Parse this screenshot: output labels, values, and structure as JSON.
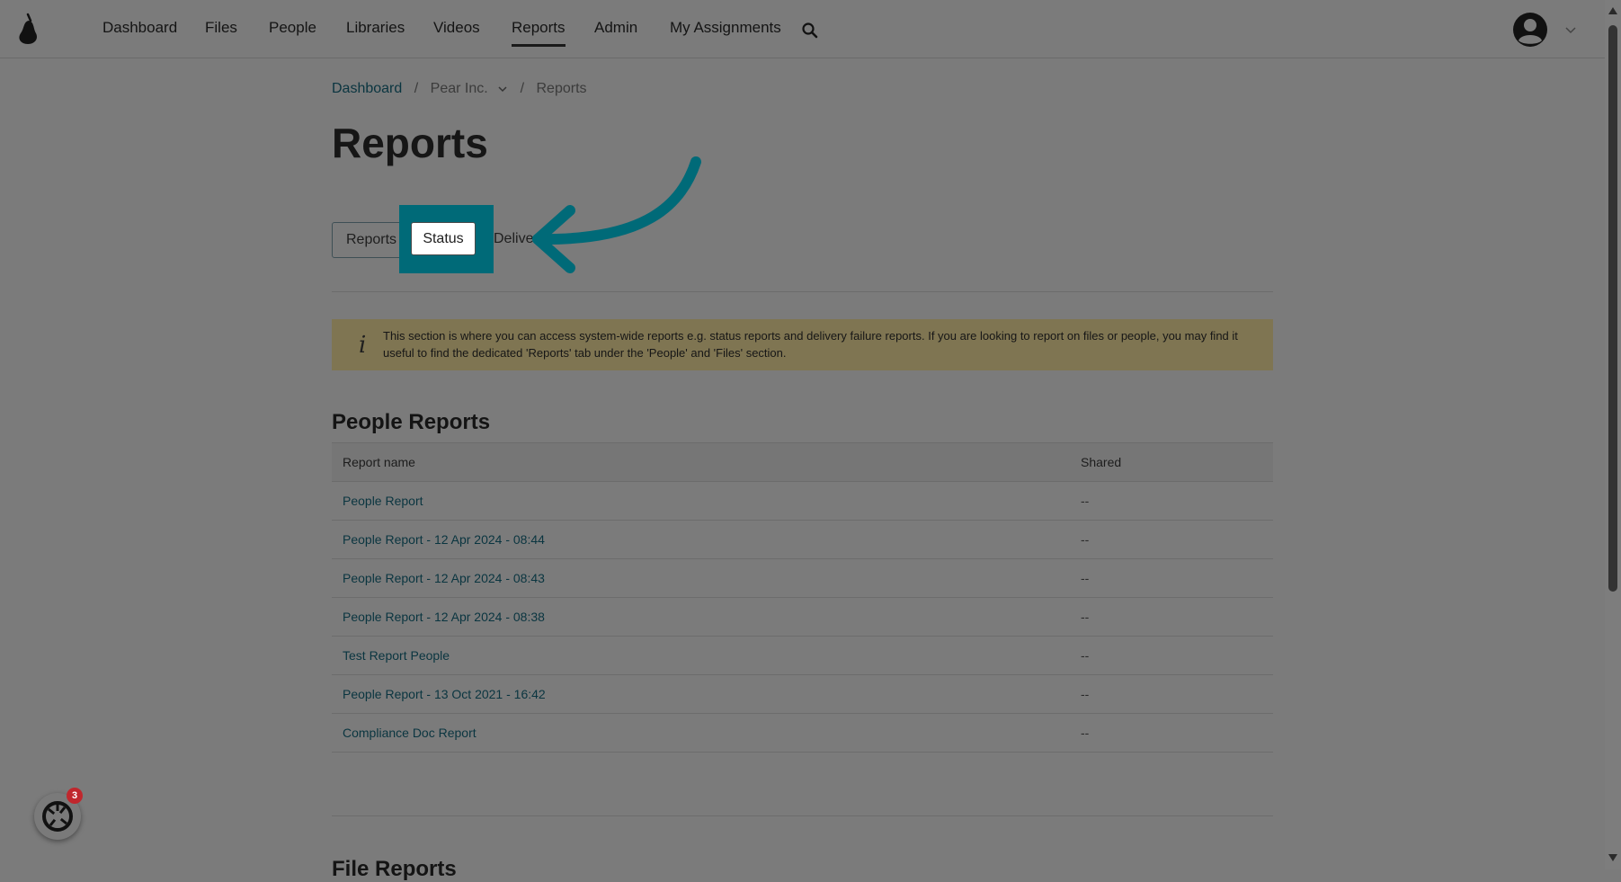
{
  "nav": {
    "items": [
      {
        "label": "Dashboard"
      },
      {
        "label": "Files"
      },
      {
        "label": "People"
      },
      {
        "label": "Libraries"
      },
      {
        "label": "Videos"
      },
      {
        "label": "Reports",
        "active": true
      },
      {
        "label": "Admin"
      },
      {
        "label": "My Assignments"
      }
    ],
    "icons": [
      "pear-logo-icon",
      "search-icon",
      "user-avatar-icon",
      "chevron-down-icon"
    ]
  },
  "breadcrumb": {
    "home": "Dashboard",
    "org": "Pear Inc.",
    "current": "Reports",
    "separator": "/"
  },
  "page": {
    "title": "Reports"
  },
  "tabs": {
    "reports": "Reports",
    "status": "Status",
    "delivery": "Delivery"
  },
  "info": {
    "icon": "i",
    "text": "This section is where you can access system-wide reports e.g. status reports and delivery failure reports. If you are looking to report on files or people, you may find it useful to find the dedicated 'Reports' tab under the 'People' and 'Files' section."
  },
  "people_reports": {
    "title": "People Reports",
    "columns": {
      "name": "Report name",
      "shared": "Shared"
    },
    "rows": [
      {
        "name": "People Report",
        "shared": "--"
      },
      {
        "name": "People Report - 12 Apr 2024 - 08:44",
        "shared": "--"
      },
      {
        "name": "People Report - 12 Apr 2024 - 08:43",
        "shared": "--"
      },
      {
        "name": "People Report - 12 Apr 2024 - 08:38",
        "shared": "--"
      },
      {
        "name": "Test Report People",
        "shared": "--"
      },
      {
        "name": "People Report - 13 Oct 2021 - 16:42",
        "shared": "--"
      },
      {
        "name": "Compliance Doc Report",
        "shared": "--"
      }
    ]
  },
  "file_reports": {
    "title": "File Reports"
  },
  "chat": {
    "badge": "3"
  },
  "colors": {
    "highlight": "#006a78",
    "link": "#0a3540",
    "info_bg": "#7f7552",
    "badge": "#c0272d"
  }
}
